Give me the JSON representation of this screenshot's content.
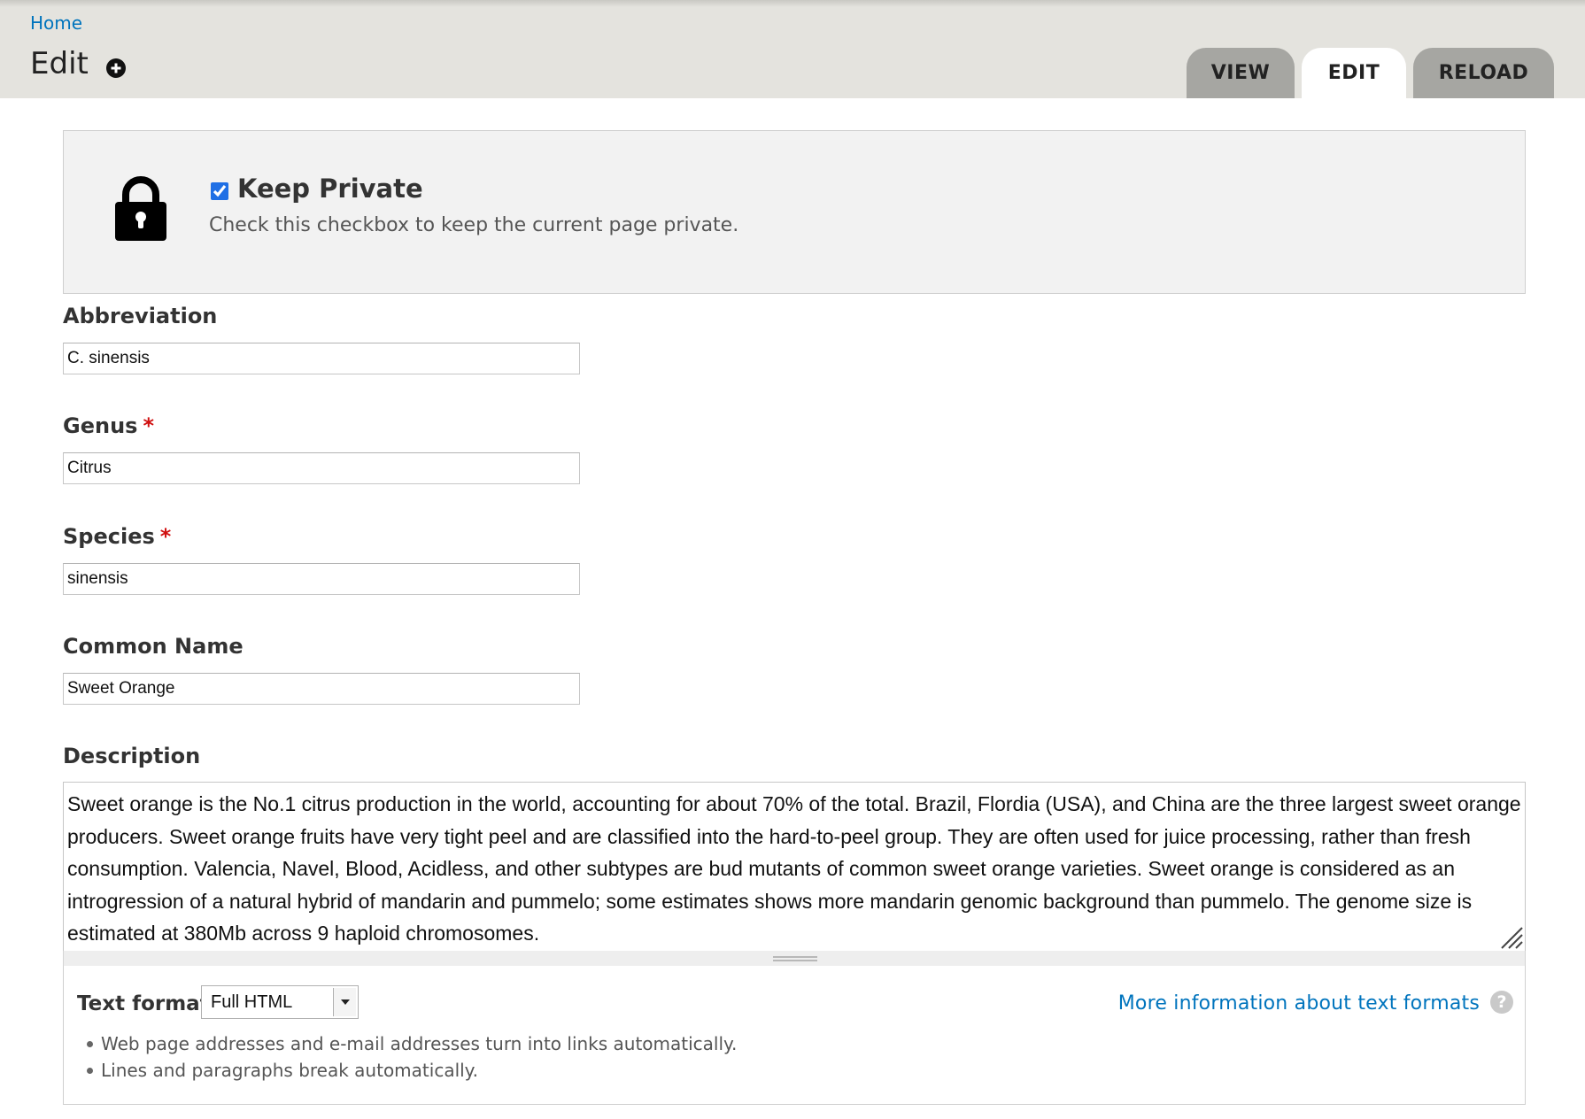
{
  "breadcrumb": {
    "home": "Home"
  },
  "page": {
    "title": "Edit"
  },
  "tabs": [
    {
      "label": "VIEW",
      "active": false
    },
    {
      "label": "EDIT",
      "active": true
    },
    {
      "label": "RELOAD",
      "active": false
    }
  ],
  "private_panel": {
    "title": "Keep Private",
    "description": "Check this checkbox to keep the current page private.",
    "checked": true,
    "icon": "lock-icon"
  },
  "fields": {
    "abbreviation": {
      "label": "Abbreviation",
      "value": "C. sinensis",
      "required": false
    },
    "genus": {
      "label": "Genus",
      "value": "Citrus",
      "required": true
    },
    "species": {
      "label": "Species",
      "value": "sinensis",
      "required": true
    },
    "common_name": {
      "label": "Common Name",
      "value": "Sweet Orange",
      "required": false
    },
    "description": {
      "label": "Description",
      "value": "Sweet orange is the No.1 citrus production in the world, accounting for about 70% of the total. Brazil, Flordia (USA), and China are the three largest sweet orange producers. Sweet orange fruits have very tight peel and are classified into the hard-to-peel group. They are often used for juice processing, rather than fresh consumption. Valencia, Navel, Blood, Acidless, and other subtypes are bud mutants of common sweet orange varieties. Sweet orange is considered as an introgression of a natural hybrid of mandarin and pummelo; some estimates shows more mandarin genomic background than pummelo. The genome size is estimated at 380Mb across 9 haploid chromosomes."
    }
  },
  "required_marker": "*",
  "text_format": {
    "label": "Text format",
    "selected": "Full HTML",
    "help_link": "More information about text formats",
    "help_icon": "?",
    "tips": [
      "Web page addresses and e-mail addresses turn into links automatically.",
      "Lines and paragraphs break automatically."
    ]
  },
  "colors": {
    "link": "#0074bd",
    "header_bg": "#e4e3de",
    "tab_inactive": "#a6a6a2",
    "required": "#d01010",
    "checkbox": "#1f6fe5"
  }
}
